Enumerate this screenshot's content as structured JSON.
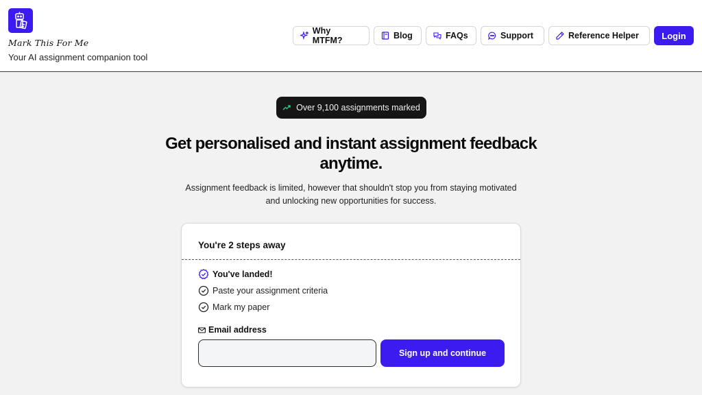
{
  "brand": {
    "name": "Mark This For Me",
    "tagline": "Your AI assignment companion tool",
    "accent": "#3b1bf0"
  },
  "nav": {
    "why": {
      "label": "Why MTFM?",
      "icon": "sparkle-icon"
    },
    "blog": {
      "label": "Blog",
      "icon": "book-icon"
    },
    "faqs": {
      "label": "FAQs",
      "icon": "chat-bubbles-icon"
    },
    "support": {
      "label": "Support",
      "icon": "chat-icon"
    },
    "reference": {
      "label": "Reference Helper",
      "icon": "pencil-icon"
    },
    "login": {
      "label": "Login"
    }
  },
  "hero": {
    "badge": "Over 9,100 assignments marked",
    "badge_icon": "trending-up-icon",
    "headline": "Get personalised and instant assignment feedback anytime.",
    "subtext": "Assignment feedback is limited, however that shouldn't stop you from staying motivated and unlocking new opportunities for success."
  },
  "card": {
    "title": "You're 2 steps away",
    "steps": [
      {
        "label": "You've landed!",
        "active": true
      },
      {
        "label": "Paste your assignment criteria",
        "active": false
      },
      {
        "label": "Mark my paper",
        "active": false
      }
    ],
    "email_label": "Email address",
    "email_value": "",
    "submit_label": "Sign up and continue"
  }
}
